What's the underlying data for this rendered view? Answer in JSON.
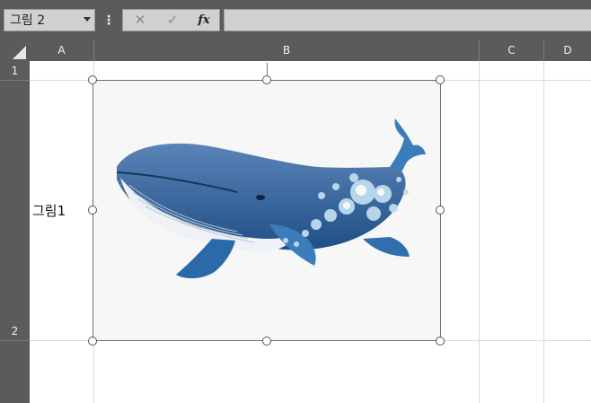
{
  "formula_bar": {
    "name_box_value": "그림 2",
    "more_icon": "⋮",
    "cancel_icon": "✕",
    "enter_icon": "✓",
    "function_icon": "fx",
    "formula_value": ""
  },
  "columns": [
    "A",
    "B",
    "C",
    "D"
  ],
  "rows": [
    "1",
    "2"
  ],
  "cells": {
    "A2": "그림1"
  },
  "picture": {
    "subject": "whale illustration",
    "colors": {
      "body_dark": "#1f4f86",
      "body_mid": "#3a78b8",
      "belly": "#eef2f6",
      "flower": "#bfdcef",
      "background": "#f7f7f7"
    }
  }
}
